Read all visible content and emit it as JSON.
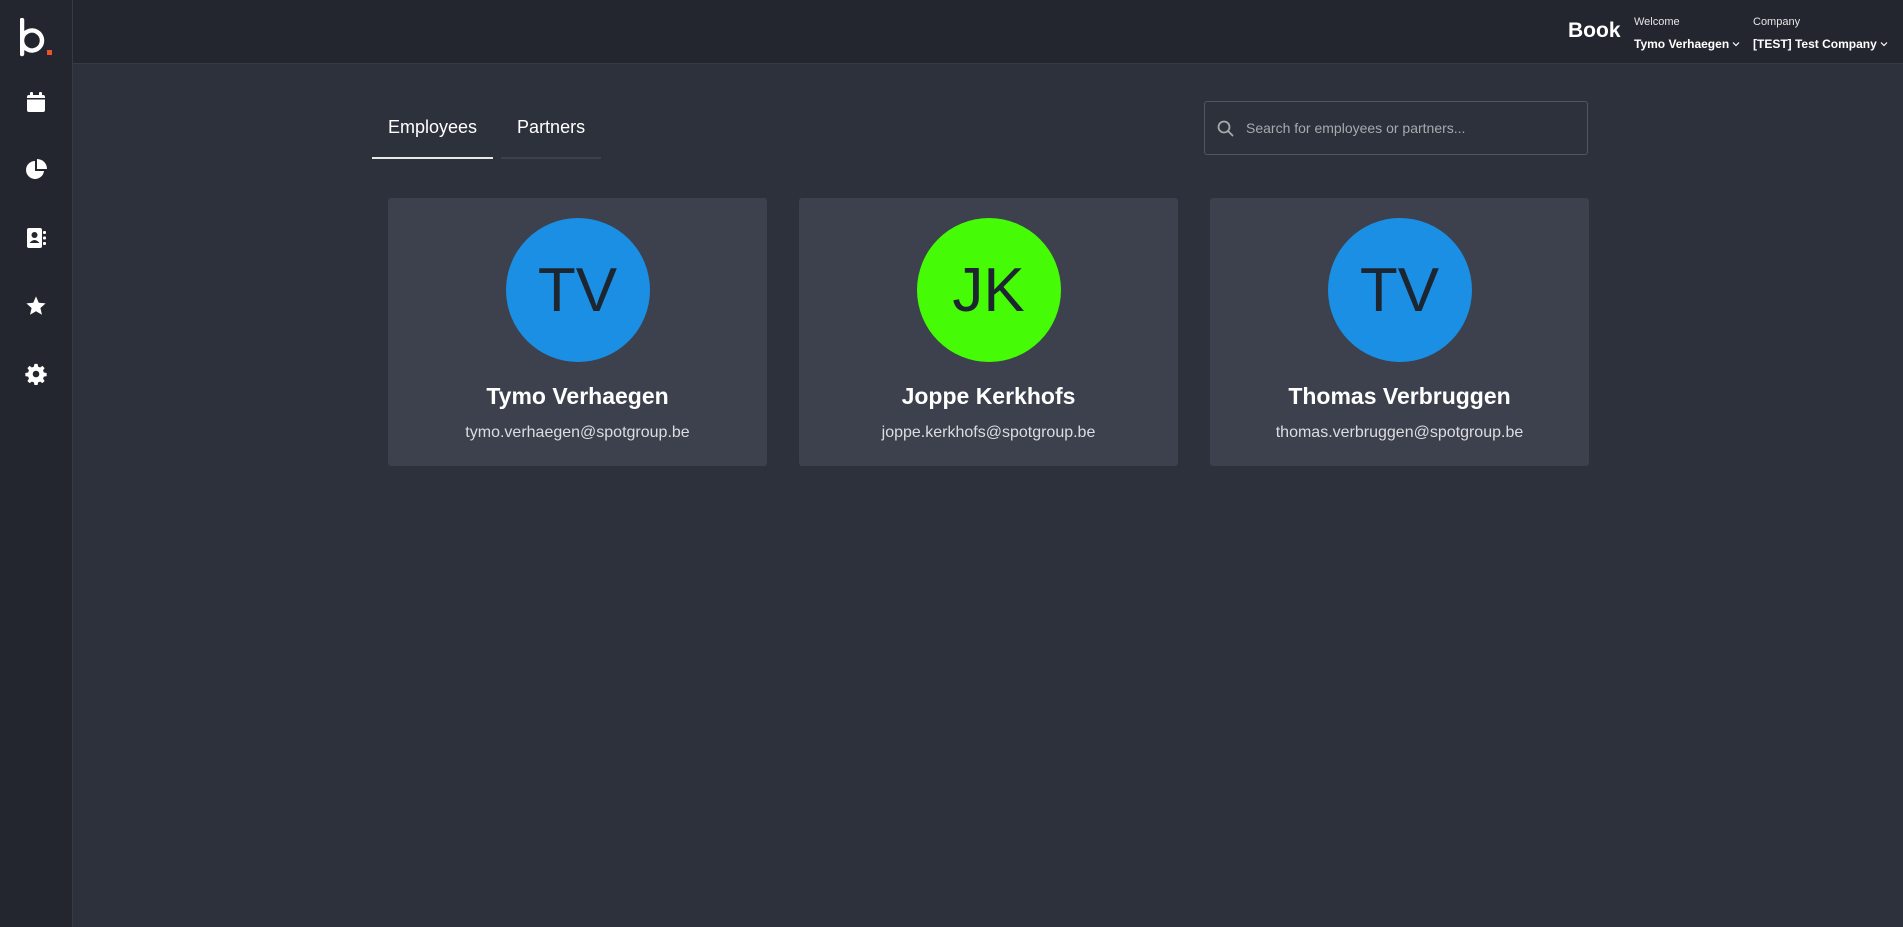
{
  "header": {
    "app_title": "Book",
    "welcome_label": "Welcome",
    "user_name": "Tymo Verhaegen",
    "company_label": "Company",
    "company_name": "[TEST] Test Company"
  },
  "sidebar": {
    "items": [
      {
        "icon": "calendar-icon"
      },
      {
        "icon": "pie-chart-icon"
      },
      {
        "icon": "address-book-icon"
      },
      {
        "icon": "star-icon"
      },
      {
        "icon": "gear-icon"
      }
    ]
  },
  "tabs": [
    {
      "label": "Employees",
      "active": true
    },
    {
      "label": "Partners",
      "active": false
    }
  ],
  "search": {
    "placeholder": "Search for employees or partners...",
    "value": ""
  },
  "people": [
    {
      "initials": "TV",
      "name": "Tymo Verhaegen",
      "email": "tymo.verhaegen@spotgroup.be",
      "color": "#1a8fe3"
    },
    {
      "initials": "JK",
      "name": "Joppe Kerkhofs",
      "email": "joppe.kerkhofs@spotgroup.be",
      "color": "#45fb05"
    },
    {
      "initials": "TV",
      "name": "Thomas Verbruggen",
      "email": "thomas.verbruggen@spotgroup.be",
      "color": "#1a8fe3"
    }
  ],
  "colors": {
    "background": "#2d313b",
    "sidebar": "#23262e",
    "card": "#3d414d",
    "logo_accent": "#e8542c"
  }
}
